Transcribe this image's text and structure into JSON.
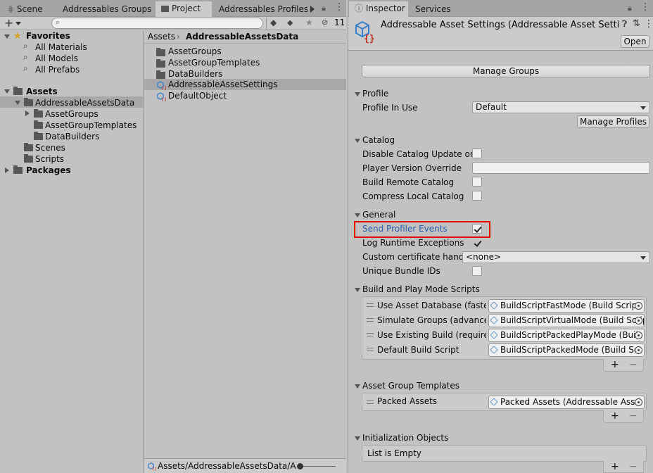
{
  "left_tabs": [
    {
      "label": "Scene",
      "active": false
    },
    {
      "label": "Addressables Groups",
      "active": false
    },
    {
      "label": "Project",
      "active": true
    },
    {
      "label": "Addressables Profiles",
      "active": false
    }
  ],
  "right_tabs": [
    {
      "label": "Inspector",
      "active": true
    },
    {
      "label": "Services",
      "active": false
    }
  ],
  "project": {
    "search_placeholder": "",
    "hidden_count": "11",
    "tree": {
      "favorites": {
        "label": "Favorites",
        "items": [
          "All Materials",
          "All Models",
          "All Prefabs"
        ]
      },
      "assets": {
        "label": "Assets",
        "selected": "AddressableAssetsData",
        "children": [
          "AssetGroups",
          "AssetGroupTemplates",
          "DataBuilders"
        ],
        "other": [
          "Scenes",
          "Scripts"
        ]
      },
      "packages": {
        "label": "Packages"
      }
    },
    "breadcrumb": {
      "root": "Assets",
      "current": "AddressableAssetsData"
    },
    "files": [
      {
        "label": "AssetGroups",
        "type": "folder"
      },
      {
        "label": "AssetGroupTemplates",
        "type": "folder"
      },
      {
        "label": "DataBuilders",
        "type": "folder"
      },
      {
        "label": "AddressableAssetSettings",
        "type": "asset",
        "selected": true
      },
      {
        "label": "DefaultObject",
        "type": "asset"
      }
    ],
    "status_path": "Assets/AddressableAssetsData/Ass"
  },
  "inspector": {
    "title": "Addressable Asset Settings (Addressable Asset Setti",
    "open_label": "Open",
    "manage_groups_label": "Manage Groups",
    "profile": {
      "header": "Profile",
      "in_use_label": "Profile In Use",
      "in_use_value": "Default",
      "manage_label": "Manage Profiles"
    },
    "catalog": {
      "header": "Catalog",
      "disable_update": "Disable Catalog Update on",
      "player_version": "Player Version Override",
      "build_remote": "Build Remote Catalog",
      "compress_local": "Compress Local Catalog"
    },
    "general": {
      "header": "General",
      "send_profiler": "Send Profiler Events",
      "log_runtime": "Log Runtime Exceptions",
      "cert_handler": "Custom certificate handler",
      "cert_value": "<none>",
      "unique_bundle": "Unique Bundle IDs"
    },
    "build_scripts": {
      "header": "Build and Play Mode Scripts",
      "items": [
        {
          "label": "Use Asset Database (faster)",
          "value": "BuildScriptFastMode (Build Script"
        },
        {
          "label": "Simulate Groups (advanced",
          "value": "BuildScriptVirtualMode (Build Scrip"
        },
        {
          "label": "Use Existing Build (requires",
          "value": "BuildScriptPackedPlayMode (Buil"
        },
        {
          "label": "Default Build Script",
          "value": "BuildScriptPackedMode (Build Sc"
        }
      ]
    },
    "templates": {
      "header": "Asset Group Templates",
      "items": [
        {
          "label": "Packed Assets",
          "value": "Packed Assets (Addressable Asse"
        }
      ]
    },
    "init_objects": {
      "header": "Initialization Objects",
      "empty": "List is Empty"
    },
    "plus": "+",
    "minus": "−"
  },
  "colors": {
    "accent_text": "#2a5aa8",
    "highlight_box": "#e00000",
    "selection": "#a8a8a8"
  }
}
